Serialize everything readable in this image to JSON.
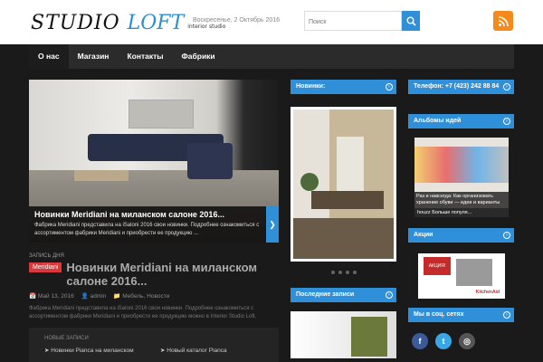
{
  "brand": {
    "studio": "STUDIO",
    "loft": "LOFT",
    "tagline": "interior studio"
  },
  "date": "Воскресенье, 2 Октябрь 2016",
  "search": {
    "placeholder": "Поиск"
  },
  "nav": {
    "items": [
      "О нас",
      "Магазин",
      "Контакты",
      "Фабрики"
    ]
  },
  "slider": {
    "title": "Новинки Meridiani на миланском салоне 2016...",
    "text": "Фабрика Meridiani представила на iSaloni 2016 свои новинки.   Подробнее ознакомиться с ассортиментом фабрики Meridiani и приобрести ее продукцию ..."
  },
  "post": {
    "label": "ЗАПИСЬ ДНЯ",
    "badge": "Meridiani",
    "title": "Новинки Meridiani на миланском салоне 2016...",
    "date": "Май 13, 2016",
    "author": "admin",
    "category": "Мебель, Новости",
    "excerpt": "Фабрика Meridiani представила на iSaloni 2016 свои новинки.   Подробнее ознакомиться с ассортиментом фабрики Meridiani и приобрести ее продукцию можно в Interior Studio Loft."
  },
  "new_posts": {
    "header": "НОВЫЕ ЗАПИСИ",
    "item1": "Новинки Pianca на миланском",
    "item2": "Новый каталог Pianca"
  },
  "col2": {
    "novinki": "Новинки:",
    "posledn": "Последние записи"
  },
  "col3": {
    "phone": "Телефон: +7 (423) 242 88 84",
    "albums": "Альбомы идей",
    "ideas_caption": "Раз и навсегда: Как организовать хранение обуви — идеи и варианты",
    "houzz": "houzz   Больше популя...",
    "akcii": "Акции",
    "social": "Мы в соц. сетях",
    "promo_badge": "АКЦИЯ!",
    "promo_brand": "KitchenAid"
  },
  "colors": {
    "accent": "#2f8fd8",
    "rss": "#f48a1c",
    "badge": "#d9393b"
  }
}
